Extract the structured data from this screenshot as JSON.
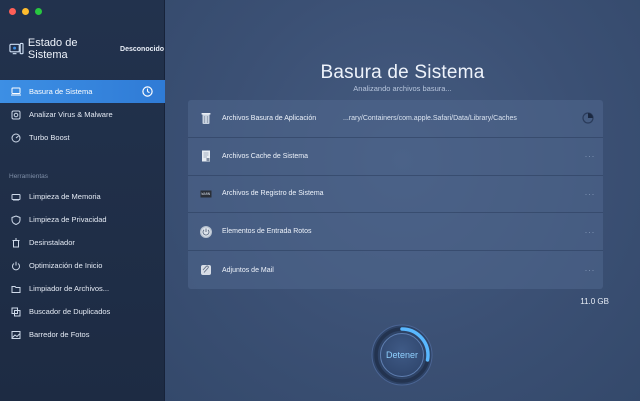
{
  "window": {
    "traffic_lights": [
      "close",
      "minimize",
      "zoom"
    ]
  },
  "brand": {
    "title": "Estado de Sistema",
    "status": "Desconocido"
  },
  "sidebar": {
    "top_items": [
      {
        "label": "Basura de Sistema",
        "icon": "laptop-icon",
        "active": true
      },
      {
        "label": "Analizar Virus & Malware",
        "icon": "shield-scan-icon",
        "active": false
      },
      {
        "label": "Turbo Boost",
        "icon": "speedometer-icon",
        "active": false
      }
    ],
    "section_label": "Herramientas",
    "tools": [
      {
        "label": "Limpieza de Memoria",
        "icon": "memory-icon"
      },
      {
        "label": "Limpieza de Privacidad",
        "icon": "privacy-shield-icon"
      },
      {
        "label": "Desinstalador",
        "icon": "trash-icon"
      },
      {
        "label": "Optimización de Inicio",
        "icon": "power-icon"
      },
      {
        "label": "Limpiador de Archivos...",
        "icon": "folder-icon"
      },
      {
        "label": "Buscador de Duplicados",
        "icon": "duplicates-icon"
      },
      {
        "label": "Barredor de Fotos",
        "icon": "photo-icon"
      }
    ]
  },
  "main": {
    "title": "Basura de Sistema",
    "subtitle": "Analizando archivos basura...",
    "rows": [
      {
        "label": "Archivos Basura de Aplicación",
        "path": "...rary/Containers/com.apple.Safari/Data/Library/Caches",
        "state": "scanning",
        "icon": "trash-can-icon"
      },
      {
        "label": "Archivos Cache de Sistema",
        "path": "",
        "state": "pending",
        "icon": "document-icon",
        "dots": "···"
      },
      {
        "label": "Archivos de Registro de Sistema",
        "path": "",
        "state": "pending",
        "icon": "log-icon",
        "dots": "···"
      },
      {
        "label": "Elementos de Entrada Rotos",
        "path": "",
        "state": "pending",
        "icon": "power-button-icon",
        "dots": "···"
      },
      {
        "label": "Adjuntos de Mail",
        "path": "",
        "state": "pending",
        "icon": "attachment-icon",
        "dots": "···"
      }
    ],
    "total_size": "11.0 GB",
    "stop_button": "Detener",
    "scan_progress": 0.28
  },
  "colors": {
    "accent": "#3d8fe4",
    "sidebar_bg": "#1f2e48",
    "main_bg": "#3b5074",
    "stop_text": "#8fd0ff"
  }
}
